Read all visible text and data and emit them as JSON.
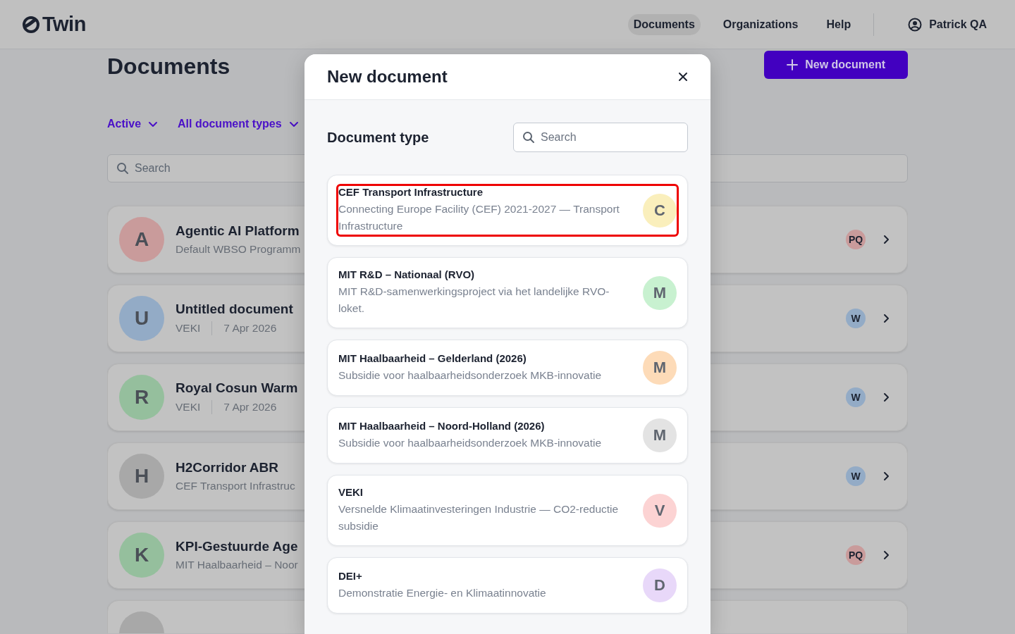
{
  "header": {
    "logo": "Twin",
    "nav": [
      {
        "label": "Documents",
        "selected": true
      },
      {
        "label": "Organizations",
        "selected": false
      },
      {
        "label": "Help",
        "selected": false
      }
    ],
    "user": "Patrick QA"
  },
  "page": {
    "title": "Documents",
    "new_button": "New document",
    "filters": [
      "Active",
      "All document types"
    ],
    "search": {
      "placeholder": "Search"
    },
    "documents": [
      {
        "initial": "A",
        "color": "#c99b9b",
        "title": "Agentic AI Platform",
        "meta": [
          "Default WBSO Programm"
        ],
        "owner": {
          "initials": "PQ",
          "color": "#c99b9b"
        }
      },
      {
        "initial": "U",
        "color": "#93abc6",
        "title": "Untitled document",
        "meta": [
          "VEKI",
          "7 Apr 2026"
        ],
        "owner": {
          "initials": "W",
          "color": "#93abc6"
        }
      },
      {
        "initial": "R",
        "color": "#95bf9d",
        "title": "Royal Cosun Warm",
        "meta": [
          "VEKI",
          "7 Apr 2026"
        ],
        "owner": {
          "initials": "W",
          "color": "#93abc6"
        }
      },
      {
        "initial": "H",
        "color": "#a8a8a8",
        "title": "H2Corridor ABR",
        "meta": [
          "CEF Transport Infrastruc"
        ],
        "owner": {
          "initials": "W",
          "color": "#93abc6"
        }
      },
      {
        "initial": "K",
        "color": "#95bf9d",
        "title": "KPI-Gestuurde Age",
        "meta": [
          "MIT Haalbaarheid – Noor"
        ],
        "owner": {
          "initials": "PQ",
          "color": "#c99b9b"
        }
      },
      {
        "color": "#a8a8a8"
      }
    ]
  },
  "modal": {
    "title": "New document",
    "section": "Document type",
    "search": {
      "placeholder": "Search"
    },
    "types": [
      {
        "name": "CEF Transport Infrastructure",
        "description": "Connecting Europe Facility (CEF) 2021-2027 — Transport Infrastructure",
        "initial": "C",
        "color": "#faefbc",
        "highlighted": true
      },
      {
        "name": "MIT R&D – Nationaal (RVO)",
        "description": "MIT R&D-samenwerkingsproject via het landelijke RVO-loket.",
        "initial": "M",
        "color": "#c8f1d0",
        "highlighted": false
      },
      {
        "name": "MIT Haalbaarheid – Gelderland (2026)",
        "description": "Subsidie voor haalbaarheidsonderzoek MKB-innovatie",
        "initial": "M",
        "color": "#fddbb8",
        "highlighted": false
      },
      {
        "name": "MIT Haalbaarheid – Noord-Holland (2026)",
        "description": "Subsidie voor haalbaarheidsonderzoek MKB-innovatie",
        "initial": "M",
        "color": "#e3e3e3",
        "highlighted": false
      },
      {
        "name": "VEKI",
        "description": "Versnelde Klimaatinvesteringen Industrie — CO2-reductie subsidie",
        "initial": "V",
        "color": "#fcd3d3",
        "highlighted": false
      },
      {
        "name": "DEI+",
        "description": "Demonstratie Energie- en Klimaatinnovatie",
        "initial": "D",
        "color": "#e8d8f9",
        "highlighted": false
      }
    ]
  }
}
